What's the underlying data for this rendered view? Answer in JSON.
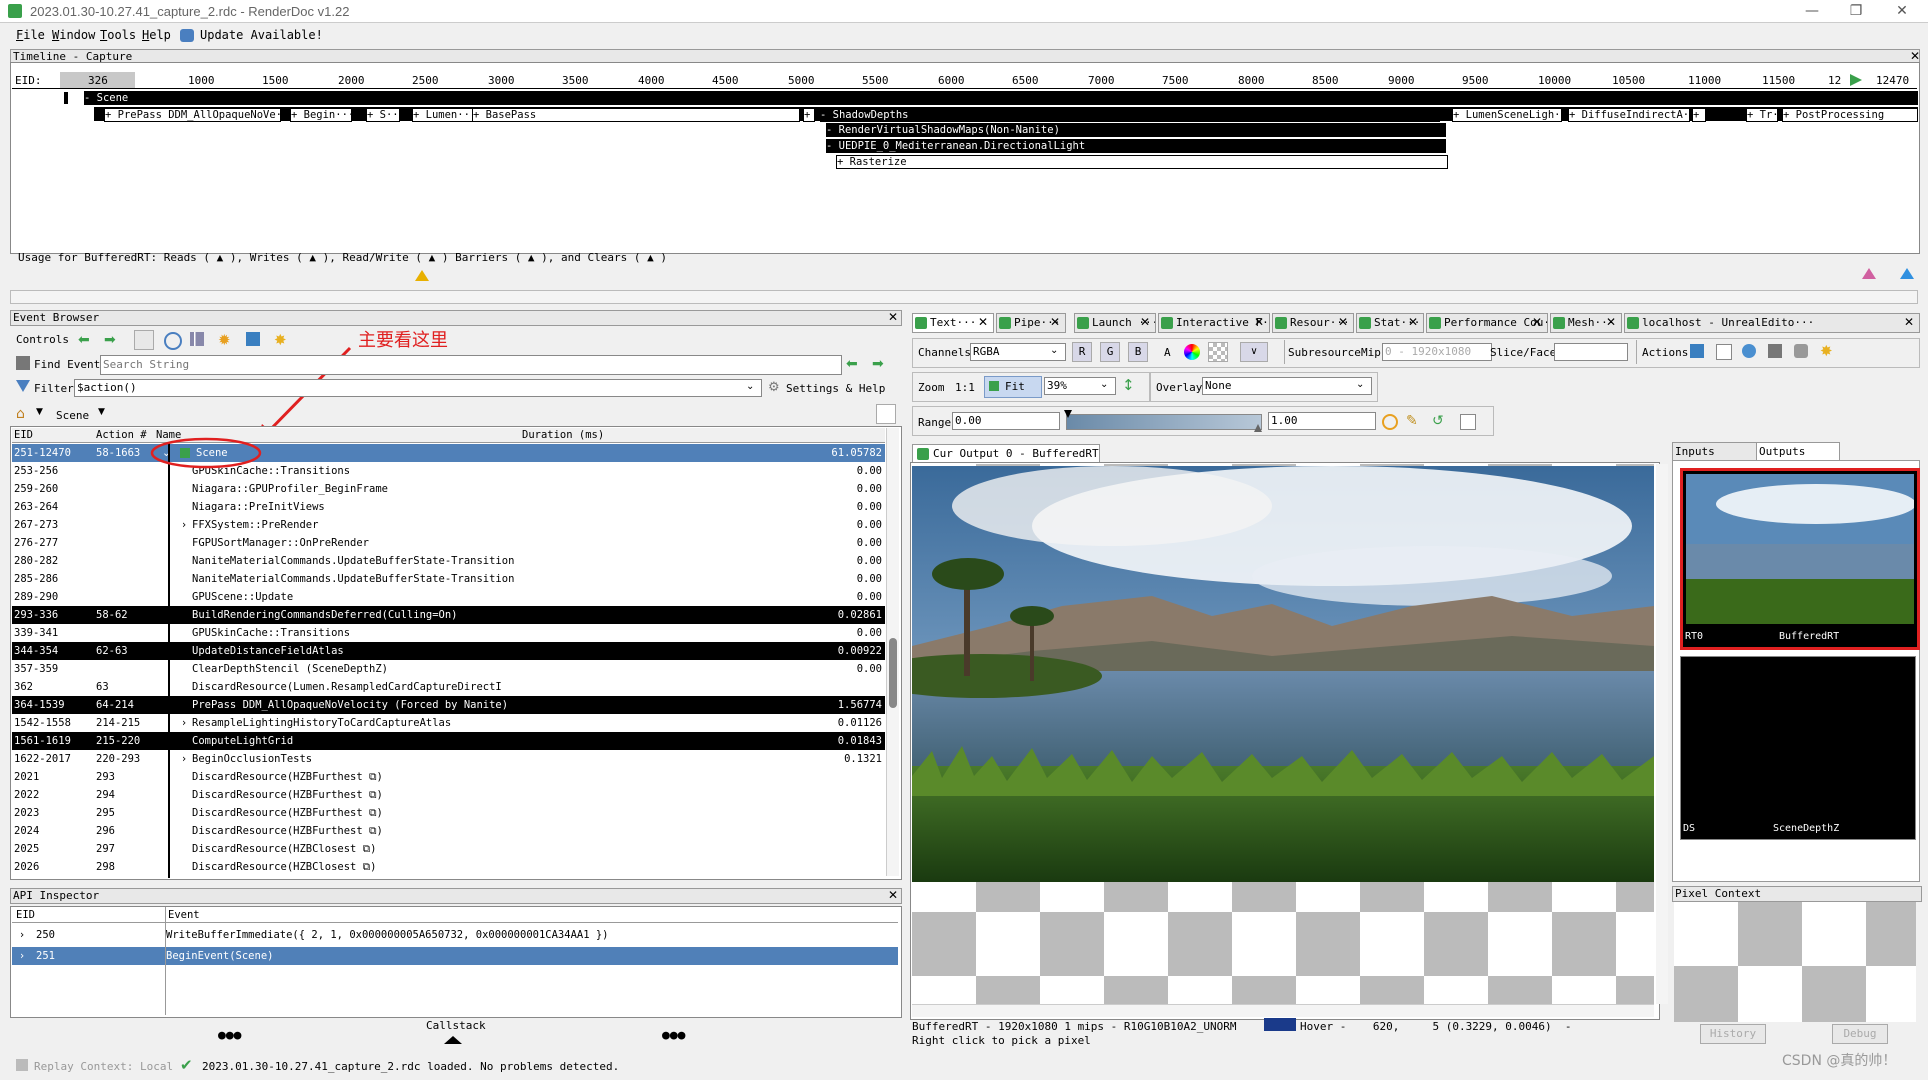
{
  "window": {
    "title": "2023.01.30-10.27.41_capture_2.rdc - RenderDoc v1.22"
  },
  "menu": {
    "file": "File",
    "window": "Window",
    "tools": "Tools",
    "help": "Help",
    "update": "Update Available!"
  },
  "timeline": {
    "header": "Timeline - Capture",
    "eid_label": "EID:",
    "current_eid": "326",
    "ticks": [
      "1000",
      "1500",
      "2000",
      "2500",
      "3000",
      "3500",
      "4000",
      "4500",
      "5000",
      "5500",
      "6000",
      "6500",
      "7000",
      "7500",
      "8000",
      "8500",
      "9000",
      "9500",
      "10000",
      "10500",
      "11000",
      "11500",
      "12",
      "12470"
    ],
    "scene_label": "- Scene",
    "row1": [
      "+ PrePass DDM_AllOpaqueNoVe···",
      "+ Begin···",
      "+ S···",
      "+ Lumen···",
      "+ BasePass",
      "+",
      "- ShadowDepths",
      "+ LumenSceneLigh···",
      "+ DiffuseIndirectA···",
      "+",
      "+ Tr···",
      "+ PostProcessing"
    ],
    "shadow_vsm": "- RenderVirtualShadowMaps(Non-Nanite)",
    "shadow_light": "- UEDPIE_0_Mediterranean.DirectionalLight",
    "rasterize": "+ Rasterize",
    "usage_text": "Usage for BufferedRT: Reads ( ▲ ), Writes ( ▲ ), Read/Write ( ▲ ) Barriers ( ▲ ), and Clears ( ▲ )"
  },
  "event_browser": {
    "header": "Event Browser",
    "controls_label": "Controls",
    "find_label": "Find Event",
    "find_placeholder": "Search String",
    "filter_label": "Filter",
    "filter_value": "$action()",
    "settings_label": "Settings & Help",
    "scene_crumb": "Scene",
    "annotation": "主要看这里",
    "columns": [
      "EID",
      "Action #",
      "Name",
      "Duration (ms)"
    ],
    "rows": [
      {
        "eid": "251-12470",
        "action": "58-1663",
        "name": "Scene",
        "dur": "61.05782",
        "style": "sel",
        "expander": "v"
      },
      {
        "eid": "253-256",
        "action": "",
        "name": "GPUSkinCache::Transitions",
        "dur": "0.00",
        "style": "",
        "expander": ""
      },
      {
        "eid": "259-260",
        "action": "",
        "name": "Niagara::GPUProfiler_BeginFrame",
        "dur": "0.00",
        "style": "",
        "expander": ""
      },
      {
        "eid": "263-264",
        "action": "",
        "name": "Niagara::PreInitViews",
        "dur": "0.00",
        "style": "",
        "expander": ""
      },
      {
        "eid": "267-273",
        "action": "",
        "name": "FFXSystem::PreRender",
        "dur": "0.00",
        "style": "",
        "expander": ">"
      },
      {
        "eid": "276-277",
        "action": "",
        "name": "FGPUSortManager::OnPreRender",
        "dur": "0.00",
        "style": "",
        "expander": ""
      },
      {
        "eid": "280-282",
        "action": "",
        "name": "NaniteMaterialCommands.UpdateBufferState-Transition",
        "dur": "0.00",
        "style": "",
        "expander": ""
      },
      {
        "eid": "285-286",
        "action": "",
        "name": "NaniteMaterialCommands.UpdateBufferState-Transition",
        "dur": "0.00",
        "style": "",
        "expander": ""
      },
      {
        "eid": "289-290",
        "action": "",
        "name": "GPUScene::Update",
        "dur": "0.00",
        "style": "",
        "expander": ""
      },
      {
        "eid": "293-336",
        "action": "58-62",
        "name": "BuildRenderingCommandsDeferred(Culling=On)",
        "dur": "0.02861",
        "style": "black",
        "expander": ""
      },
      {
        "eid": "339-341",
        "action": "",
        "name": "GPUSkinCache::Transitions",
        "dur": "0.00",
        "style": "",
        "expander": ""
      },
      {
        "eid": "344-354",
        "action": "62-63",
        "name": "UpdateDistanceFieldAtlas",
        "dur": "0.00922",
        "style": "black",
        "expander": ""
      },
      {
        "eid": "357-359",
        "action": "",
        "name": "ClearDepthStencil (SceneDepthZ)",
        "dur": "0.00",
        "style": "",
        "expander": ""
      },
      {
        "eid": "362",
        "action": "63",
        "name": "DiscardResource(Lumen.ResampledCardCaptureDirectI",
        "dur": "",
        "style": "",
        "expander": ""
      },
      {
        "eid": "364-1539",
        "action": "64-214",
        "name": "PrePass DDM_AllOpaqueNoVelocity (Forced by Nanite)",
        "dur": "1.56774",
        "style": "black",
        "expander": ""
      },
      {
        "eid": "1542-1558",
        "action": "214-215",
        "name": "ResampleLightingHistoryToCardCaptureAtlas",
        "dur": "0.01126",
        "style": "",
        "expander": ">"
      },
      {
        "eid": "1561-1619",
        "action": "215-220",
        "name": "ComputeLightGrid",
        "dur": "0.01843",
        "style": "black",
        "expander": ""
      },
      {
        "eid": "1622-2017",
        "action": "220-293",
        "name": "BeginOcclusionTests",
        "dur": "0.1321",
        "style": "",
        "expander": ">"
      },
      {
        "eid": "2021",
        "action": "293",
        "name": "DiscardResource(HZBFurthest ⧉)",
        "dur": "",
        "style": "",
        "expander": ""
      },
      {
        "eid": "2022",
        "action": "294",
        "name": "DiscardResource(HZBFurthest ⧉)",
        "dur": "",
        "style": "",
        "expander": ""
      },
      {
        "eid": "2023",
        "action": "295",
        "name": "DiscardResource(HZBFurthest ⧉)",
        "dur": "",
        "style": "",
        "expander": ""
      },
      {
        "eid": "2024",
        "action": "296",
        "name": "DiscardResource(HZBFurthest ⧉)",
        "dur": "",
        "style": "",
        "expander": ""
      },
      {
        "eid": "2025",
        "action": "297",
        "name": "DiscardResource(HZBClosest ⧉)",
        "dur": "",
        "style": "",
        "expander": ""
      },
      {
        "eid": "2026",
        "action": "298",
        "name": "DiscardResource(HZBClosest ⧉)",
        "dur": "",
        "style": "",
        "expander": ""
      }
    ]
  },
  "api_inspector": {
    "header": "API Inspector",
    "columns": [
      "EID",
      "Event"
    ],
    "rows": [
      {
        "eid": "250",
        "event": "WriteBufferImmediate({ 2, 1, 0x000000005A650732, 0x000000001CA34AA1 })"
      },
      {
        "eid": "251",
        "event": "BeginEvent(Scene)"
      }
    ],
    "callstack": "Callstack",
    "dots": "●●●"
  },
  "status": {
    "replay": "Replay Context: Local",
    "loaded": "2023.01.30-10.27.41_capture_2.rdc loaded. No problems detected."
  },
  "tabs": [
    "Text···",
    "Pipe···",
    "Launch ···",
    "Interactive F···",
    "Resour···",
    "Stat···",
    "Performance Cou···",
    "Mesh···",
    "localhost - UnrealEdito···"
  ],
  "texture_viewer": {
    "channels_label": "Channels",
    "channels_value": "RGBA",
    "r": "R",
    "g": "G",
    "b": "B",
    "a": "A",
    "subresource_label": "Subresource",
    "mip_label": "Mip",
    "mip_value": "0 - 1920x1080",
    "slice_label": "Slice/Face",
    "actions_label": "Actions",
    "zoom_label": "Zoom",
    "zoom_1to1": "1:1",
    "fit_label": "Fit",
    "zoom_value": "39%",
    "overlay_label": "Overlay",
    "overlay_value": "None",
    "range_label": "Range",
    "range_min": "0.00",
    "range_max": "1.00",
    "output_tab": "Cur Output 0 - BufferedRT",
    "inputs_tab": "Inputs",
    "outputs_tab": "Outputs",
    "thumb1_left": "RT0",
    "thumb1_right": "BufferedRT",
    "thumb2_left": "DS",
    "thumb2_right": "SceneDepthZ",
    "pixel_context": "Pixel Context",
    "history_btn": "History",
    "debug_btn": "Debug",
    "status_line": "BufferedRT - 1920x1080 1 mips - R10G10B10A2_UNORM",
    "hover_text": "Hover -    620,     5 (0.3229, 0.0046)  -",
    "hint": "Right click to pick a pixel"
  },
  "watermark": "CSDN @真的帅！"
}
